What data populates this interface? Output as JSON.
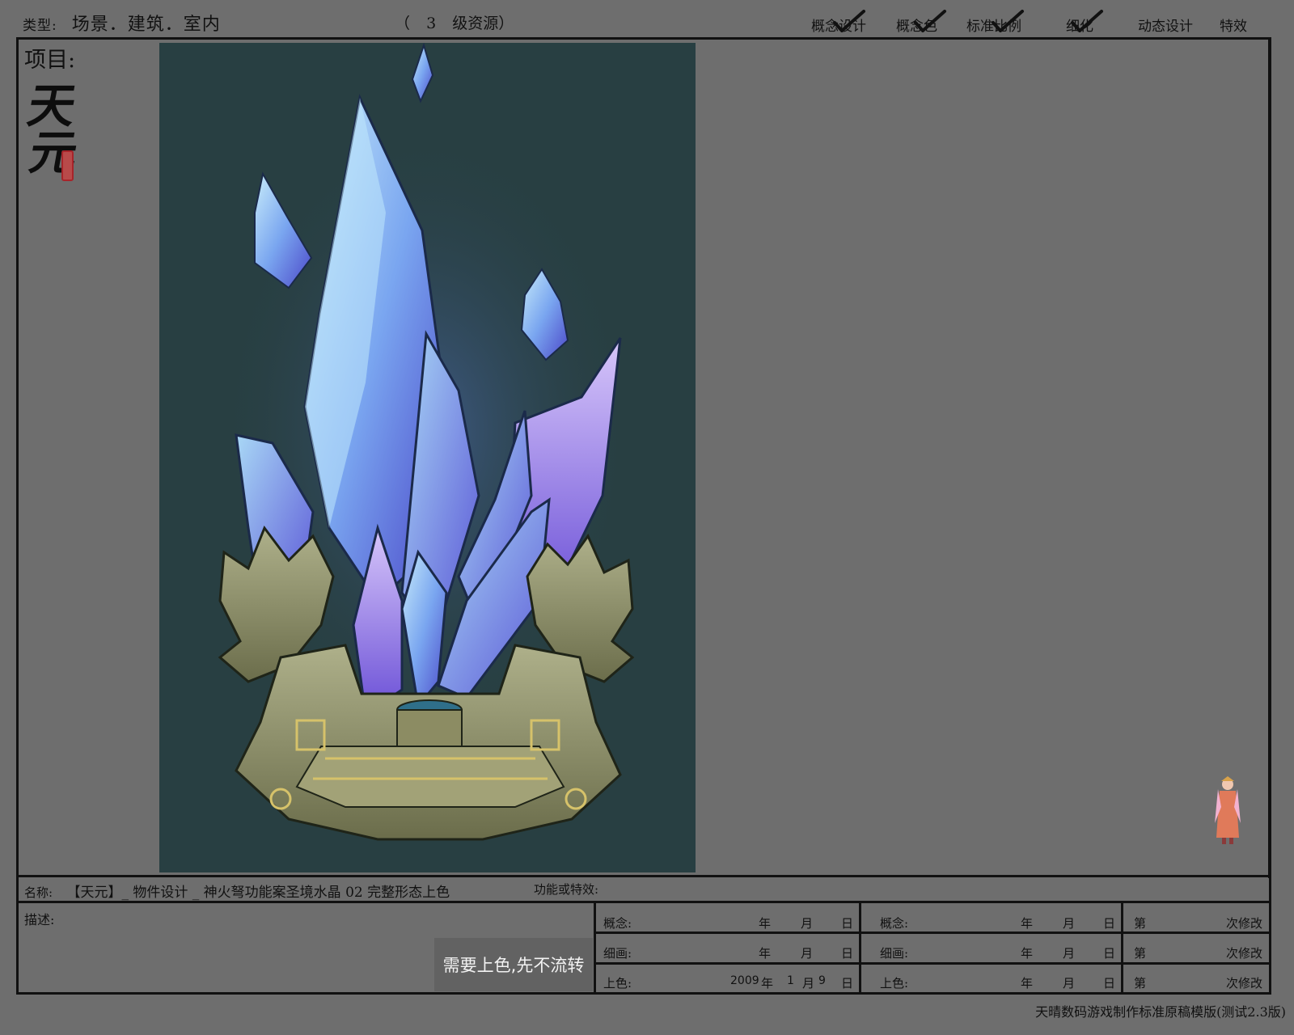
{
  "header": {
    "type_label": "类型:",
    "type_value": "场景．建筑．室内",
    "level_open": "（",
    "level_number": "3",
    "level_text": "级资源）",
    "stages": [
      {
        "label": "概念设计",
        "checked": true
      },
      {
        "label": "概念色",
        "checked": true
      },
      {
        "label": "标准比例",
        "checked": true
      },
      {
        "label": "细化",
        "checked": true
      },
      {
        "label": "动态设计",
        "checked": false
      },
      {
        "label": "特效",
        "checked": false
      }
    ]
  },
  "project": {
    "label": "项目:",
    "logo_chars": [
      "天",
      "元"
    ]
  },
  "artwork": {
    "background_color": "#283f42",
    "crystal_colors": [
      "#b9e4f7",
      "#7fa8f2",
      "#5d59d8",
      "#9a6fe0"
    ],
    "pedestal_colors": [
      "#8f8e66",
      "#c9bd76",
      "#4d5c48"
    ]
  },
  "info": {
    "name_label": "名称:",
    "name_value": "【天元】_ 物件设计 _ 神火弩功能案圣境水晶 02 完整形态上色",
    "function_label": "功能或特效:",
    "desc_label": "描述:",
    "stamp_text": "需要上色,先不流转"
  },
  "schedule": {
    "col1": [
      {
        "label": "概念:",
        "year": "",
        "month": "",
        "day": ""
      },
      {
        "label": "细画:",
        "year": "",
        "month": "",
        "day": ""
      },
      {
        "label": "上色:",
        "year": "2009",
        "month": "1",
        "day": "9"
      }
    ],
    "col2": [
      {
        "label": "概念:"
      },
      {
        "label": "细画:"
      },
      {
        "label": "上色:"
      }
    ],
    "units": {
      "year": "年",
      "month": "月",
      "day": "日"
    },
    "revisions": {
      "prefix": "第",
      "suffix": "次修改",
      "count": 3
    }
  },
  "footer": {
    "text": "天晴数码游戏制作标准原稿模版(测试2.3版)"
  }
}
